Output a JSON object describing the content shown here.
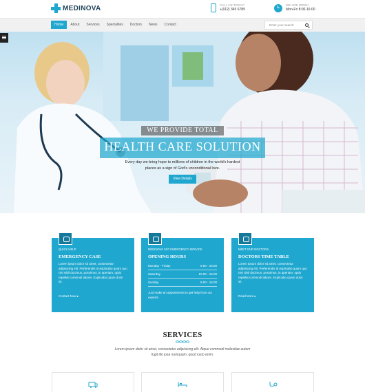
{
  "header": {
    "logo": "MEDINOVA",
    "call_label": "CALL US TODAY!",
    "call_value": "+(012) 345 6789",
    "open_label": "WE ARE OPEN!",
    "open_value": "Mon-Fri 8:00-16:00"
  },
  "nav": {
    "items": [
      "Home",
      "About",
      "Services",
      "Specialties",
      "Doctors",
      "News",
      "Contact"
    ],
    "active": "Home",
    "search_placeholder": "Enter your search"
  },
  "hero": {
    "line1": "WE PROVIDE TOTAL",
    "line2": "HEALTH CARE SOLUTION",
    "subtitle": "Every day we bring hope to millions of children in the world's hardest places as a sign of God's unconditional love.",
    "button": "View Details"
  },
  "cards": [
    {
      "kicker": "QUICK HELP",
      "title": "EMERGENCY CASE",
      "text": "Lorem ipsum dolor sit amet, consectetur adipisicing elit. Perferendis id explicabo quam quo nisi nihil ducimus, possimus, in aperiam, optio repellat commodi labore. Explicabo quam dolor sit.",
      "link": "Contact Now"
    },
    {
      "kicker": "MEDINOVA 24/7 EMERGENCY SERVICE",
      "title": "OPENING HOURS",
      "hours": [
        {
          "day": "Monday - Friday",
          "time": "9.00 - 20.00"
        },
        {
          "day": "Saturday",
          "time": "10.00 - 16.00"
        },
        {
          "day": "Sunday",
          "time": "9.00 - 16.00"
        }
      ],
      "footer": "Just make an appointment to get help from our experts"
    },
    {
      "kicker": "MEET OUR DOCTORS",
      "title": "DOCTORS TIME TABLE",
      "text": "Lorem ipsum dolor sit amet, consectetur adipisicing elit. Perferendis id explicabo quam quo nisi nihil ducimus, possimus, in aperiam, optio repellat commodi labore. Explicabo quam dolor sit.",
      "link": "Read More"
    }
  ],
  "services": {
    "title": "SERVICES",
    "description": "Lorem ipsum dolor sit amet, consectetur adipisicing elit. Atque commodi molestiae autem fugit illo ipsa numquam, quod iusto enim."
  },
  "colors": {
    "accent": "#1fa7cf",
    "dark": "#21445a"
  }
}
